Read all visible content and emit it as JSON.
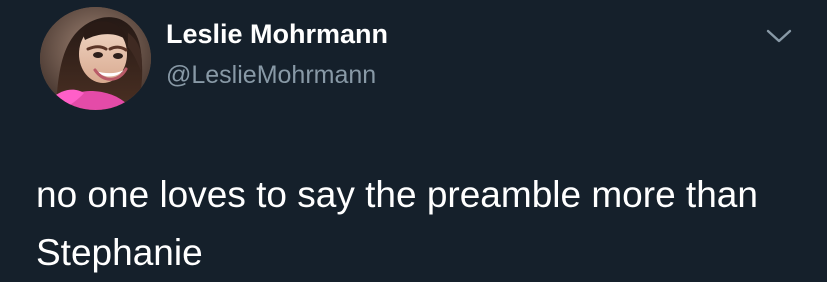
{
  "tweet": {
    "author": {
      "display_name": "Leslie Mohrmann",
      "handle": "@LeslieMohrmann",
      "avatar_icon": "profile-photo"
    },
    "menu_icon": "chevron-down-icon",
    "text": "no one loves to say the preamble more than Stephanie"
  },
  "colors": {
    "background": "#15202b",
    "primary_text": "#ffffff",
    "secondary_text": "#8899a6"
  }
}
